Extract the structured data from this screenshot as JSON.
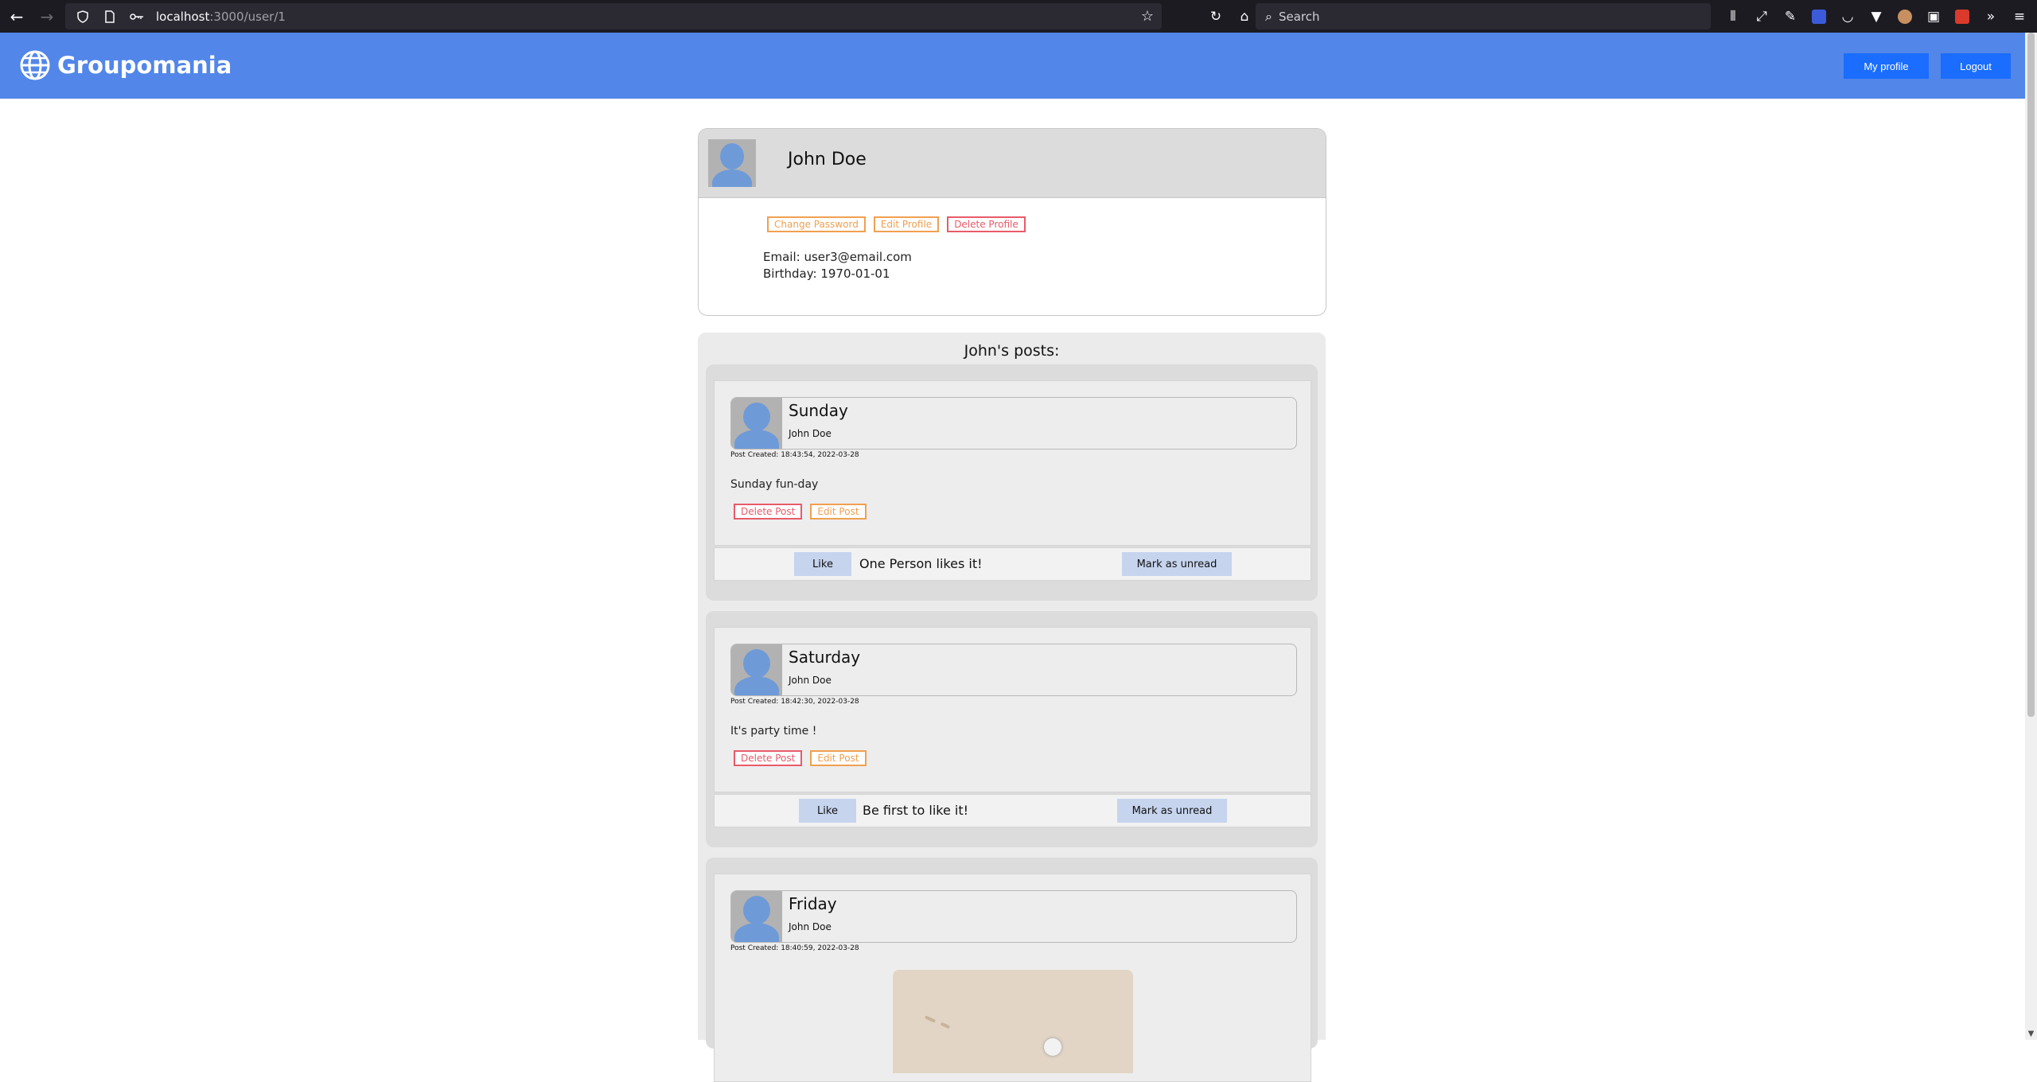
{
  "browser": {
    "url_host": "localhost",
    "url_path": ":3000/user/1",
    "search_placeholder": "Search"
  },
  "header": {
    "brand": "Groupomania",
    "my_profile_label": "My profile",
    "logout_label": "Logout",
    "accent_color": "#5286e9",
    "button_color": "#1a6dff"
  },
  "profile": {
    "name": "John Doe",
    "change_password_label": "Change Password",
    "edit_profile_label": "Edit Profile",
    "delete_profile_label": "Delete Profile",
    "email_line": "Email: user3@email.com",
    "birthday_line": "Birthday: 1970-01-01"
  },
  "posts_title": "John's posts:",
  "posts": [
    {
      "title": "Sunday",
      "author": "John Doe",
      "created": "Post Created: 18:43:54, 2022-03-28",
      "body": "Sunday fun-day",
      "delete_label": "Delete Post",
      "edit_label": "Edit Post",
      "like_label": "Like",
      "likes_text": "One Person likes it!",
      "unread_label": "Mark as unread"
    },
    {
      "title": "Saturday",
      "author": "John Doe",
      "created": "Post Created: 18:42:30, 2022-03-28",
      "body": "It's party time !",
      "delete_label": "Delete Post",
      "edit_label": "Edit Post",
      "like_label": "Like",
      "likes_text": "Be first to like it!",
      "unread_label": "Mark as unread"
    },
    {
      "title": "Friday",
      "author": "John Doe",
      "created": "Post Created: 18:40:59, 2022-03-28"
    }
  ]
}
